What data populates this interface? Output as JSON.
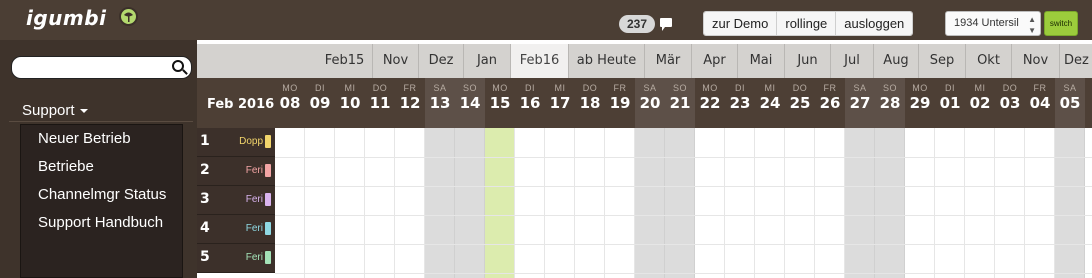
{
  "header": {
    "logo_text": "igumbi",
    "notification_count": "237",
    "buttons": [
      "zur Demo",
      "rollinge",
      "ausloggen"
    ],
    "unit_select_value": "1934 Untersil",
    "switch_label": "switch"
  },
  "sidebar": {
    "search_placeholder": "",
    "support_label": "Support",
    "menu_items": [
      "Neuer Betrieb",
      "Betriebe",
      "Channelmgr Status",
      "Support Handbuch"
    ]
  },
  "month_nav": {
    "tabs": [
      "Feb15",
      "Nov",
      "Dez",
      "Jan",
      "Feb16",
      "ab Heute",
      "Mär",
      "Apr",
      "Mai",
      "Jun",
      "Jul",
      "Aug",
      "Sep",
      "Okt",
      "Nov",
      "Dez"
    ],
    "active": "Feb16"
  },
  "calendar": {
    "month_label": "Feb 2016",
    "today": "15",
    "days": [
      {
        "dow": "MO",
        "num": "08",
        "weekend": false
      },
      {
        "dow": "DI",
        "num": "09",
        "weekend": false
      },
      {
        "dow": "MI",
        "num": "10",
        "weekend": false
      },
      {
        "dow": "DO",
        "num": "11",
        "weekend": false
      },
      {
        "dow": "FR",
        "num": "12",
        "weekend": false
      },
      {
        "dow": "SA",
        "num": "13",
        "weekend": true
      },
      {
        "dow": "SO",
        "num": "14",
        "weekend": true
      },
      {
        "dow": "MO",
        "num": "15",
        "weekend": false
      },
      {
        "dow": "DI",
        "num": "16",
        "weekend": false
      },
      {
        "dow": "MI",
        "num": "17",
        "weekend": false
      },
      {
        "dow": "DO",
        "num": "18",
        "weekend": false
      },
      {
        "dow": "FR",
        "num": "19",
        "weekend": false
      },
      {
        "dow": "SA",
        "num": "20",
        "weekend": true
      },
      {
        "dow": "SO",
        "num": "21",
        "weekend": true
      },
      {
        "dow": "MO",
        "num": "22",
        "weekend": false
      },
      {
        "dow": "DI",
        "num": "23",
        "weekend": false
      },
      {
        "dow": "MI",
        "num": "24",
        "weekend": false
      },
      {
        "dow": "DO",
        "num": "25",
        "weekend": false
      },
      {
        "dow": "FR",
        "num": "26",
        "weekend": false
      },
      {
        "dow": "SA",
        "num": "27",
        "weekend": true
      },
      {
        "dow": "SO",
        "num": "28",
        "weekend": true
      },
      {
        "dow": "MO",
        "num": "29",
        "weekend": false
      },
      {
        "dow": "DI",
        "num": "01",
        "weekend": false
      },
      {
        "dow": "MI",
        "num": "02",
        "weekend": false
      },
      {
        "dow": "DO",
        "num": "03",
        "weekend": false
      },
      {
        "dow": "FR",
        "num": "04",
        "weekend": false
      },
      {
        "dow": "SA",
        "num": "05",
        "weekend": true
      }
    ],
    "rows": [
      {
        "num": "1",
        "tag": "Dopp",
        "tag_color": "#f2d56b",
        "text_color": "#f2d56b"
      },
      {
        "num": "2",
        "tag": "Feri",
        "tag_color": "#f2a4a4",
        "text_color": "#f2a4a4"
      },
      {
        "num": "3",
        "tag": "Feri",
        "tag_color": "#d9b3ee",
        "text_color": "#d9b3ee"
      },
      {
        "num": "4",
        "tag": "Feri",
        "tag_color": "#8fd9e3",
        "text_color": "#8fd9e3"
      },
      {
        "num": "5",
        "tag": "Feri",
        "tag_color": "#a4e3b8",
        "text_color": "#a4e3b8"
      }
    ]
  },
  "colors": {
    "topbar": "#4b3e34",
    "sidebar": "#3e332b",
    "accent_green": "#9ccc3c",
    "today_column": "#dcecae",
    "weekend_column": "#dcdcdc"
  }
}
